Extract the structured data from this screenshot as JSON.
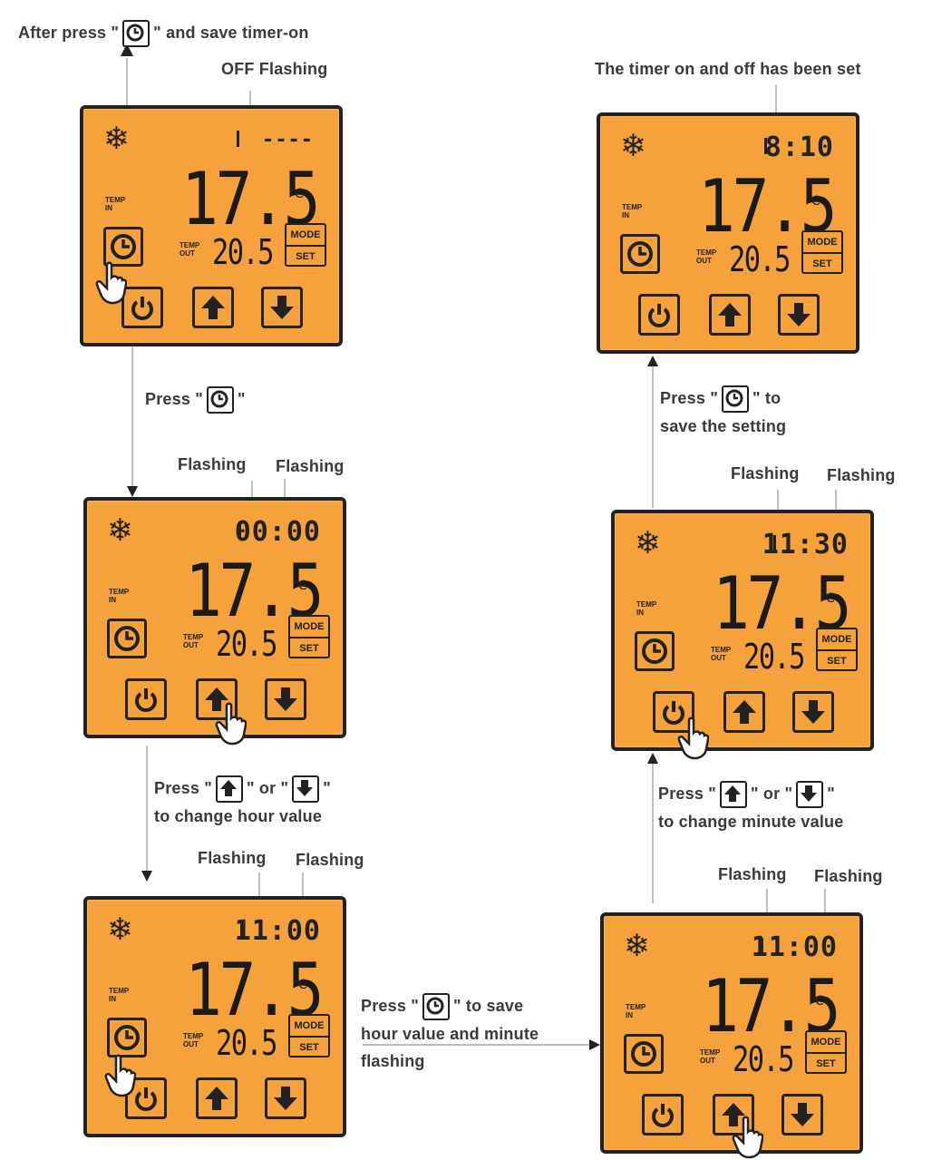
{
  "labels": {
    "after_press_before": "After press \"",
    "after_press_after": "\" and save timer-on",
    "off_flashing": "OFF Flashing",
    "timer_set": "The timer on and off has been set",
    "press1_before": "Press \"",
    "press1_after": "\"",
    "flashing_a1": "Flashing",
    "flashing_a2": "Flashing",
    "press_change_hour_1a": "Press \"",
    "press_change_hour_1b": "\" or \"",
    "press_change_hour_1c": "\"",
    "press_change_hour_2": "to change hour value",
    "flashing_b1": "Flashing",
    "flashing_b2": "Flashing",
    "press_save_hour_1a": "Press \"",
    "press_save_hour_1b": "\" to save",
    "press_save_hour_2": "hour value and minute",
    "press_save_hour_3": "flashing",
    "press_save_setting_1a": "Press \"",
    "press_save_setting_1b": "\" to",
    "press_save_setting_2": "save the setting",
    "flashing_c1": "Flashing",
    "flashing_c2": "Flashing",
    "press_change_min_1a": "Press \"",
    "press_change_min_1b": "\" or \"",
    "press_change_min_1c": "\"",
    "press_change_min_2": "to change minute value",
    "flashing_d1": "Flashing",
    "flashing_d2": "Flashing"
  },
  "panels": {
    "p1": {
      "timer": "----",
      "temp": "17.5",
      "temp_out": "20.5",
      "deg": "°C",
      "temp_in_label": "TEMP IN",
      "temp_out_label": "TEMP OUT",
      "mode": "MODE",
      "set": "SET"
    },
    "p2": {
      "timer": "00:00",
      "temp": "17.5",
      "temp_out": "20.5",
      "deg": "°C",
      "temp_in_label": "TEMP IN",
      "temp_out_label": "TEMP OUT",
      "mode": "MODE",
      "set": "SET"
    },
    "p3": {
      "timer": "11:00",
      "temp": "17.5",
      "temp_out": "20.5",
      "deg": "°C",
      "temp_in_label": "TEMP IN",
      "temp_out_label": "TEMP OUT",
      "mode": "MODE",
      "set": "SET"
    },
    "p4": {
      "timer": "11:00",
      "temp": "17.5",
      "temp_out": "20.5",
      "deg": "°C",
      "temp_in_label": "TEMP IN",
      "temp_out_label": "TEMP OUT",
      "mode": "MODE",
      "set": "SET"
    },
    "p5": {
      "timer": "11:30",
      "temp": "17.5",
      "temp_out": "20.5",
      "deg": "°C",
      "temp_in_label": "TEMP IN",
      "temp_out_label": "TEMP OUT",
      "mode": "MODE",
      "set": "SET"
    },
    "p6": {
      "timer": "8:10",
      "temp": "17.5",
      "temp_out": "20.5",
      "deg": "°C",
      "temp_in_label": "TEMP IN",
      "temp_out_label": "TEMP OUT",
      "mode": "MODE",
      "set": "SET"
    }
  },
  "icons": {
    "snowflake": "snowflake-icon",
    "clock": "clock-icon",
    "power": "power-icon",
    "up": "up-arrow-icon",
    "down": "down-arrow-icon",
    "hand": "pointing-hand-icon"
  },
  "colors": {
    "lcd_background": "#f5a23c",
    "lcd_border": "#222222",
    "label_text": "#3a3a3a",
    "connector": "#bfbfbf"
  }
}
